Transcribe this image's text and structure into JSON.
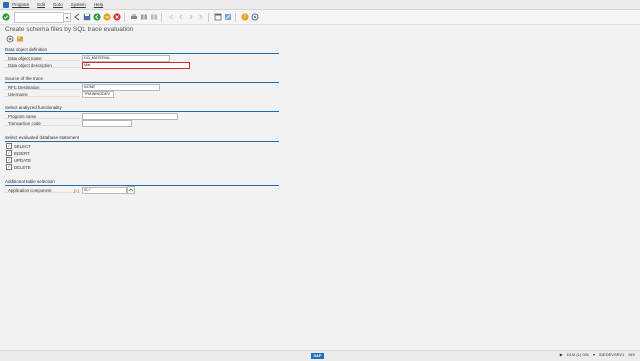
{
  "menubar": {
    "items": [
      "Program",
      "Edit",
      "Goto",
      "System",
      "Help"
    ]
  },
  "toolbar": {
    "command_placeholder": ""
  },
  "title": "Create schema files by SQL trace evaluation",
  "sections": {
    "data_object": {
      "header": "Data object definition",
      "name_label": "Data object name",
      "name_value": "DO_MATERIAL",
      "desc_label": "Data object description",
      "desc_value": "Mat"
    },
    "source": {
      "header": "Source of the trace",
      "rfc_label": "RFC Destination",
      "rfc_value": "NONE",
      "user_label": "Username",
      "user_value": "TRAININGDEV"
    },
    "functionality": {
      "header": "Select analyzed functionality",
      "program_label": "Program name",
      "program_value": "",
      "tcode_label": "Transaction code",
      "tcode_value": ""
    },
    "statements": {
      "header": "Select evaluated database statement",
      "items": [
        "SELECT",
        "INSERT",
        "UPDATE",
        "DELETE"
      ]
    },
    "additional": {
      "header": "Additional table selection",
      "app_label": "Application component",
      "app_op": "[=]",
      "app_value": "IS-*"
    }
  },
  "statusbar": {
    "system": "D1M (1) 001",
    "server": "IDEDEVSRV1",
    "mode": "INS"
  },
  "colors": {
    "section_line": "#1f6bb0",
    "focus_border": "#d12a2a",
    "sap_blue": "#1d6fbf"
  }
}
